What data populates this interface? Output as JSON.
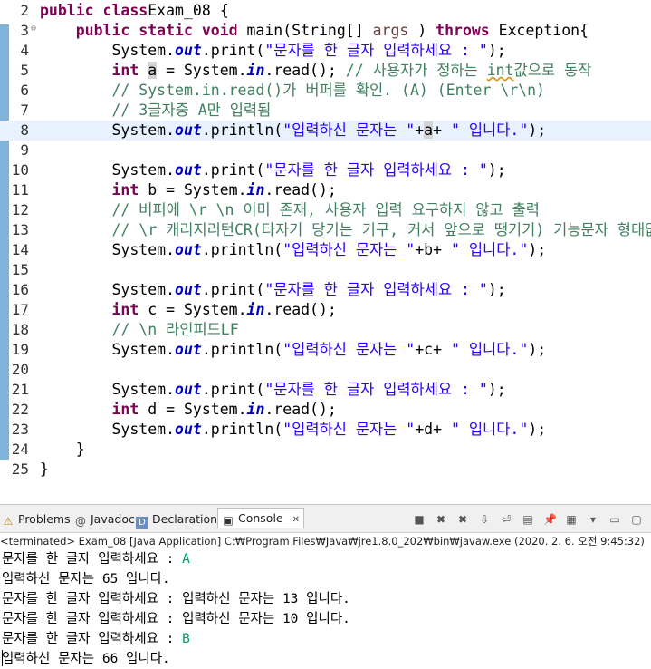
{
  "editor": {
    "lines": [
      {
        "num": "2",
        "parts": [
          [
            "kw",
            "public class"
          ],
          [
            "",
            "Exam_08 {"
          ]
        ]
      },
      {
        "num": "3",
        "fold": "⊖",
        "parts": [
          [
            "",
            "    "
          ],
          [
            "kw",
            "public static void"
          ],
          [
            "",
            " main(String[] "
          ],
          [
            "param",
            "args"
          ],
          [
            "",
            " ) "
          ],
          [
            "kw",
            "throws"
          ],
          [
            "",
            " Exception{"
          ]
        ]
      },
      {
        "num": "4",
        "parts": [
          [
            "",
            "        System."
          ],
          [
            "fld",
            "out"
          ],
          [
            "",
            ".print("
          ],
          [
            "str",
            "\"문자를 한 글자 입력하세요 : \""
          ],
          [
            "",
            ");"
          ]
        ]
      },
      {
        "num": "5",
        "parts": [
          [
            "",
            "        "
          ],
          [
            "kw",
            "int"
          ],
          [
            "",
            " "
          ],
          [
            "hl",
            "a"
          ],
          [
            "",
            " = System."
          ],
          [
            "fld",
            "in"
          ],
          [
            "",
            ".read(); "
          ],
          [
            "cmt",
            "// 사용자가 정하는 "
          ],
          [
            "cmt sq",
            "int"
          ],
          [
            "cmt",
            "값으로 동작"
          ]
        ]
      },
      {
        "num": "6",
        "parts": [
          [
            "",
            "        "
          ],
          [
            "cmt",
            "// System.in.read()가 버퍼를 확인. (A) (Enter \\r\\n)"
          ]
        ]
      },
      {
        "num": "7",
        "parts": [
          [
            "",
            "        "
          ],
          [
            "cmt",
            "// 3글자중 A만 입력됨"
          ]
        ]
      },
      {
        "num": "8",
        "current": true,
        "parts": [
          [
            "",
            "        System."
          ],
          [
            "fld",
            "out"
          ],
          [
            "",
            ".println("
          ],
          [
            "str",
            "\"입력하신 문자는 \""
          ],
          [
            "",
            "+"
          ],
          [
            "hl",
            "a"
          ],
          [
            "",
            "+ "
          ],
          [
            "str",
            "\" 입니다.\""
          ],
          [
            "",
            ");"
          ]
        ]
      },
      {
        "num": "9",
        "parts": []
      },
      {
        "num": "10",
        "parts": [
          [
            "",
            "        System."
          ],
          [
            "fld",
            "out"
          ],
          [
            "",
            ".print("
          ],
          [
            "str",
            "\"문자를 한 글자 입력하세요 : \""
          ],
          [
            "",
            ");"
          ]
        ]
      },
      {
        "num": "11",
        "parts": [
          [
            "",
            "        "
          ],
          [
            "kw",
            "int"
          ],
          [
            "",
            " b = System."
          ],
          [
            "fld",
            "in"
          ],
          [
            "",
            ".read();"
          ]
        ]
      },
      {
        "num": "12",
        "parts": [
          [
            "",
            "        "
          ],
          [
            "cmt",
            "// 버퍼에 \\r \\n 이미 존재, 사용자 입력 요구하지 않고 출력"
          ]
        ]
      },
      {
        "num": "13",
        "parts": [
          [
            "",
            "        "
          ],
          [
            "cmt",
            "// \\r 캐리지리턴CR(타자기 당기는 기구, 커서 앞으로 땡기기) 기능문자 형태없음"
          ]
        ]
      },
      {
        "num": "14",
        "parts": [
          [
            "",
            "        System."
          ],
          [
            "fld",
            "out"
          ],
          [
            "",
            ".println("
          ],
          [
            "str",
            "\"입력하신 문자는 \""
          ],
          [
            "",
            "+b+ "
          ],
          [
            "str",
            "\" 입니다.\""
          ],
          [
            "",
            ");"
          ]
        ]
      },
      {
        "num": "15",
        "parts": []
      },
      {
        "num": "16",
        "parts": [
          [
            "",
            "        System."
          ],
          [
            "fld",
            "out"
          ],
          [
            "",
            ".print("
          ],
          [
            "str",
            "\"문자를 한 글자 입력하세요 : \""
          ],
          [
            "",
            ");"
          ]
        ]
      },
      {
        "num": "17",
        "parts": [
          [
            "",
            "        "
          ],
          [
            "kw",
            "int"
          ],
          [
            "",
            " c = System."
          ],
          [
            "fld",
            "in"
          ],
          [
            "",
            ".read();"
          ]
        ]
      },
      {
        "num": "18",
        "parts": [
          [
            "",
            "        "
          ],
          [
            "cmt",
            "// \\n 라인피드LF"
          ]
        ]
      },
      {
        "num": "19",
        "parts": [
          [
            "",
            "        System."
          ],
          [
            "fld",
            "out"
          ],
          [
            "",
            ".println("
          ],
          [
            "str",
            "\"입력하신 문자는 \""
          ],
          [
            "",
            "+c+ "
          ],
          [
            "str",
            "\" 입니다.\""
          ],
          [
            "",
            ");"
          ]
        ]
      },
      {
        "num": "20",
        "parts": []
      },
      {
        "num": "21",
        "parts": [
          [
            "",
            "        System."
          ],
          [
            "fld",
            "out"
          ],
          [
            "",
            ".print("
          ],
          [
            "str",
            "\"문자를 한 글자 입력하세요 : \""
          ],
          [
            "",
            ");"
          ]
        ]
      },
      {
        "num": "22",
        "parts": [
          [
            "",
            "        "
          ],
          [
            "kw",
            "int"
          ],
          [
            "",
            " d = System."
          ],
          [
            "fld",
            "in"
          ],
          [
            "",
            ".read();"
          ]
        ]
      },
      {
        "num": "23",
        "parts": [
          [
            "",
            "        System."
          ],
          [
            "fld",
            "out"
          ],
          [
            "",
            ".println("
          ],
          [
            "str",
            "\"입력하신 문자는 \""
          ],
          [
            "",
            "+d+ "
          ],
          [
            "str",
            "\" 입니다.\""
          ],
          [
            "",
            ");"
          ]
        ]
      },
      {
        "num": "24",
        "parts": [
          [
            "",
            "    }"
          ]
        ]
      },
      {
        "num": "25",
        "parts": [
          [
            "",
            "}"
          ]
        ]
      }
    ],
    "hscroll_glyph": "<"
  },
  "tabs": {
    "problems": {
      "label": "Problems",
      "icon": "⚠"
    },
    "javadoc": {
      "label": "Javadoc",
      "icon": "@"
    },
    "declaration": {
      "label": "Declaration",
      "icon": "D"
    },
    "console": {
      "label": "Console",
      "icon": "▣",
      "close": "✕"
    }
  },
  "toolbar_icons": [
    "stop-icon",
    "remove-launch-icon",
    "remove-all-icon",
    "scroll-lock-icon",
    "word-wrap-icon",
    "show-console-icon",
    "pin-console-icon",
    "display-selected-console-icon",
    "open-console-icon",
    "minimize-icon",
    "maximize-icon"
  ],
  "toolbar_glyphs": [
    "■",
    "✖",
    "✖",
    "⇩",
    "⏎",
    "▤",
    "📌",
    "▦",
    "▾",
    "▭",
    "▢"
  ],
  "console": {
    "status": "<terminated> Exam_08 [Java Application] C:₩Program Files₩Java₩jre1.8.0_202₩bin₩javaw.exe (2020. 2. 6. 오전 9:45:32)",
    "lines": [
      {
        "text": "문자를 한 글자 입력하세요 : ",
        "input": "A"
      },
      {
        "text": "입력하신 문자는 65 입니다.",
        "input": ""
      },
      {
        "text": "문자를 한 글자 입력하세요 : 입력하신 문자는 13 입니다.",
        "input": ""
      },
      {
        "text": "문자를 한 글자 입력하세요 : 입력하신 문자는 10 입니다.",
        "input": ""
      },
      {
        "text": "문자를 한 글자 입력하세요 : ",
        "input": "B"
      },
      {
        "text": "입력하신 문자는 66 입니다.",
        "input": ""
      }
    ]
  },
  "colors": {
    "keyword": "#7f0055",
    "string": "#2a00ff",
    "comment": "#3f7f5f",
    "field": "#0000c0",
    "console_input": "#00a060"
  }
}
